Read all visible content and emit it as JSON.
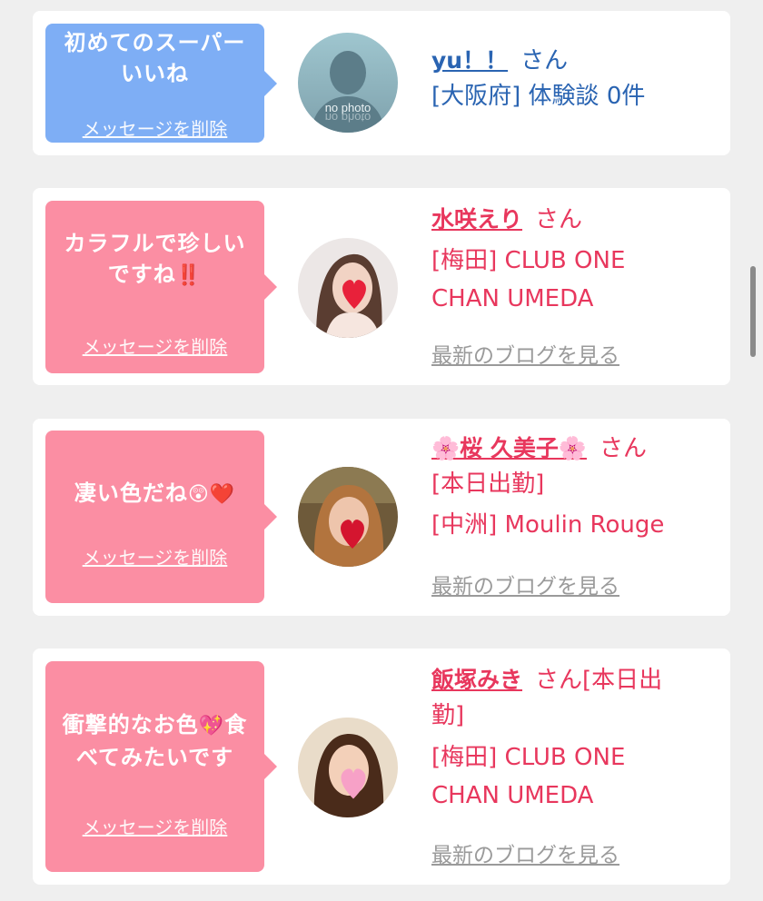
{
  "cards": [
    {
      "message": "初めてのスーパーいいね",
      "delete_label": "メッセージを削除",
      "name": "yu！！",
      "suffix": "さん",
      "detail1": "[大阪府] 体験談 0件",
      "avatar_text": "no photo",
      "bubble_color": "#7eaef5"
    },
    {
      "message_line1": "カラフルで珍しい",
      "message_line2": "ですね",
      "message_mark": "‼️",
      "delete_label": "メッセージを削除",
      "name": "水咲えり",
      "suffix": "さん",
      "detail1": "[梅田] CLUB ONE",
      "detail2": "CHAN UMEDA",
      "blog_label": "最新のブログを見る",
      "bubble_color": "#fb8ea3"
    },
    {
      "message": "凄い色だね",
      "message_mark": "😲❤️",
      "delete_label": "メッセージを削除",
      "name": "🌸桜 久美子🌸",
      "suffix": "さん",
      "detail1": "[本日出勤]",
      "detail2": "[中洲] Moulin Rouge",
      "blog_label": "最新のブログを見る",
      "bubble_color": "#fb8ea3"
    },
    {
      "message_line1a": "衝撃的なお色",
      "message_mark": "💖",
      "message_line1b": "食",
      "message_line2": "べてみたいです",
      "delete_label": "メッセージを削除",
      "name": "飯塚みき",
      "suffix": "さん[本日出",
      "suffix2": "勤]",
      "detail1": "[梅田] CLUB ONE",
      "detail2": "CHAN UMEDA",
      "blog_label": "最新のブログを見る",
      "bubble_color": "#fb8ea3"
    }
  ],
  "colors": {
    "background": "#efefef",
    "card": "#ffffff",
    "blue_accent": "#2a64b2",
    "pink_accent": "#e8375d",
    "link_gray": "#9a9a9a"
  }
}
